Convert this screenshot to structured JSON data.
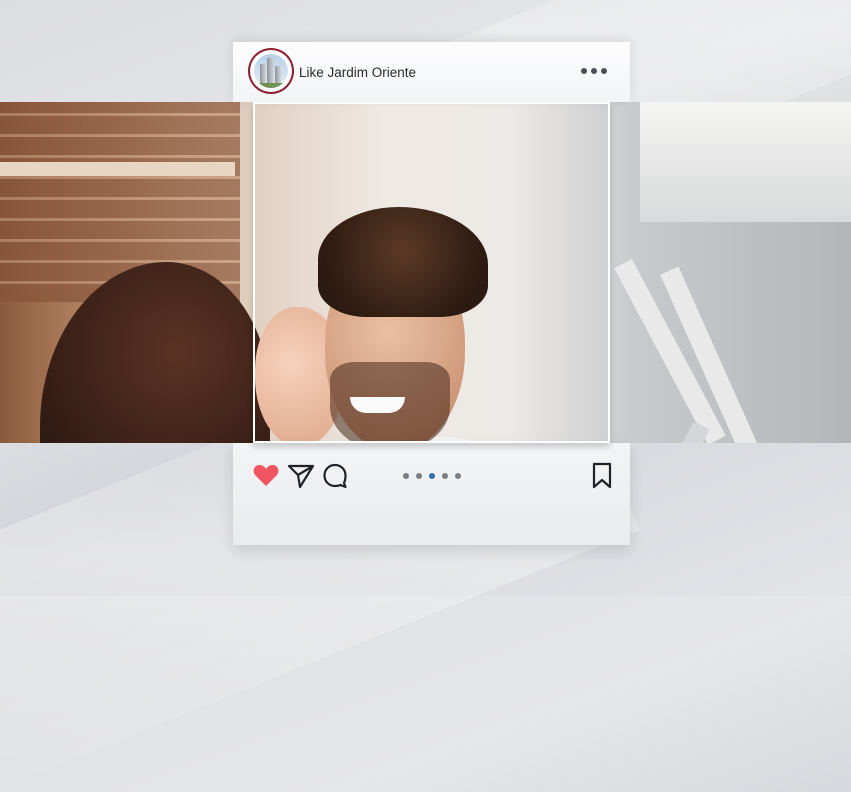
{
  "post": {
    "account_name": "Like Jardim Oriente",
    "avatar_icon": "building-logo-icon",
    "more_icon": "more-options-icon",
    "photo_description_icon": "couple-photo",
    "actions": {
      "like_icon": "heart-filled-icon",
      "like_color": "#f05561",
      "share_icon": "send-icon",
      "comment_icon": "comment-icon",
      "save_icon": "bookmark-icon"
    },
    "carousel": {
      "total": 5,
      "active_index": 2,
      "active_color": "#2e6fb0"
    }
  }
}
